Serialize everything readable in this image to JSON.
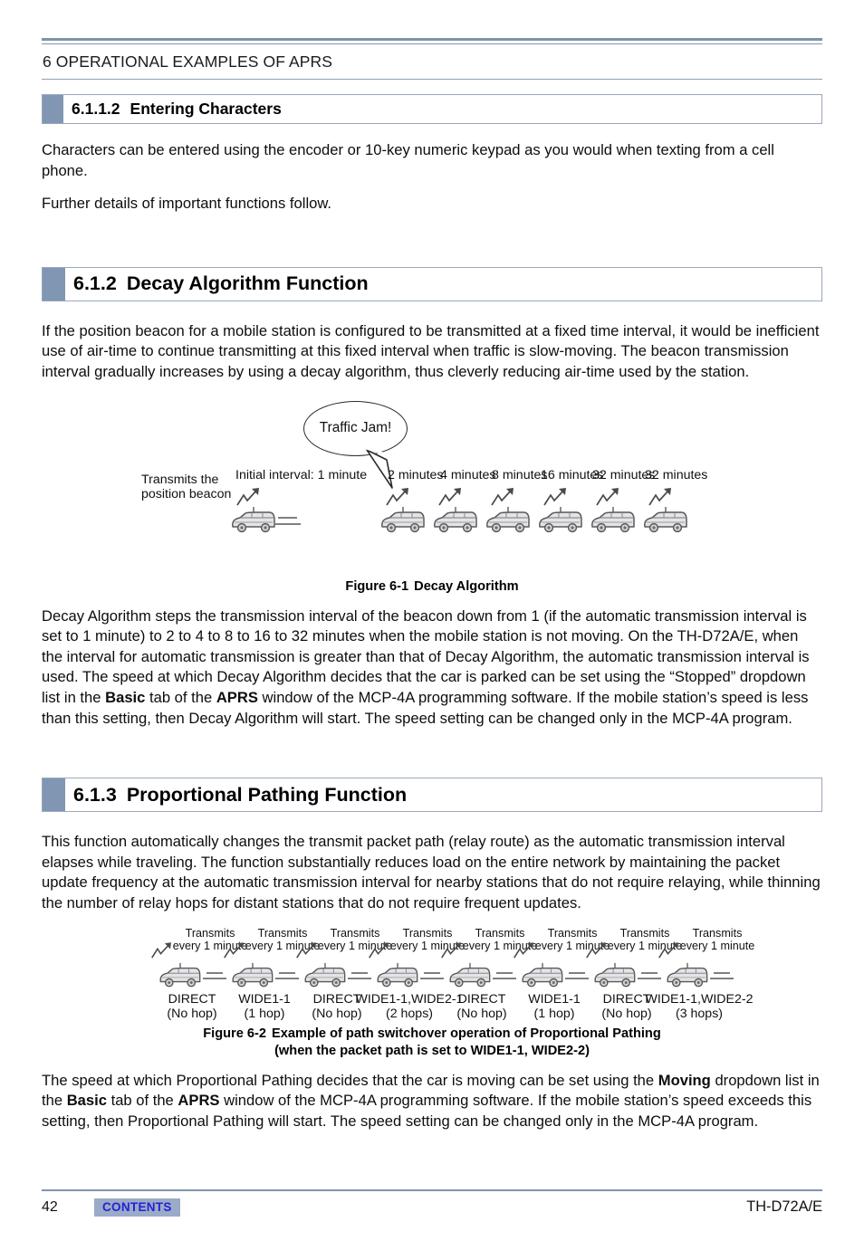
{
  "header": {
    "running_head": "6 OPERATIONAL EXAMPLES OF APRS"
  },
  "sections": [
    {
      "number": "6.1.1.2",
      "title": "Entering Characters",
      "level": 3,
      "paragraphs": [
        "Characters can be entered using the encoder or 10-key numeric keypad as you would when texting from a cell phone.",
        "Further details of important functions follow."
      ]
    },
    {
      "number": "6.1.2",
      "title": "Decay Algorithm Function",
      "level": 2,
      "intro": "If the position beacon for a mobile station is configured to be transmitted at a fixed time interval, it would be inefficient use of air-time to continue transmitting at this fixed interval when traffic is slow-moving.  The beacon transmission interval gradually increases by using a decay algorithm, thus cleverly reducing air-time used by the station."
    },
    {
      "number": "6.1.3",
      "title": "Proportional Pathing Function",
      "level": 2,
      "intro": "This function automatically changes the transmit packet path (relay route) as the automatic transmission interval elapses while traveling.  The function substantially reduces load on the entire network by maintaining the packet update frequency at the automatic transmission interval for nearby stations that do not require relaying, while thinning the number of relay hops for distant stations that do not require frequent updates."
    }
  ],
  "figure1": {
    "bubble_text": "Traffic Jam!",
    "beacon_label_line1": "Transmits the",
    "beacon_label_line2": "position beacon",
    "initial_label": "Initial interval: 1 minute",
    "interval_labels": [
      "2 minutes",
      "4 minutes",
      "8 minutes",
      "16 minutes",
      "32 minutes",
      "32 minutes"
    ],
    "caption_lead": "Figure 6-1",
    "caption_text": "Decay Algorithm"
  },
  "decay_body": {
    "para1_a": "Decay Algorithm steps the transmission interval of the beacon down from 1 (if the automatic transmission interval is set to 1 minute) to 2 to 4 to 8 to 16 to 32 minutes when the mobile station is not moving.  On the TH-D72A/E, when the interval for automatic transmission is greater than that of Decay Algorithm, the automatic transmission interval is used.  The speed at which Decay Algorithm decides that the car is parked can be set using the “Stopped” dropdown list in the ",
    "bold1": "Basic",
    "para1_b": " tab of the ",
    "bold2": "APRS",
    "para1_c": " window of the MCP-4A programming software.  If the mobile station’s speed is less than this setting, then Decay Algorithm will start.  The speed setting can be changed only in the MCP-4A program."
  },
  "figure2": {
    "transmit_line1": "Transmits",
    "transmit_line2": "every 1 minute",
    "stations": [
      {
        "path": "DIRECT",
        "hops": "(No hop)"
      },
      {
        "path": "WIDE1-1",
        "hops": "(1 hop)"
      },
      {
        "path": "DIRECT",
        "hops": "(No hop)"
      },
      {
        "path": "WIDE1-1,WIDE2-1",
        "hops": "(2 hops)"
      },
      {
        "path": "DIRECT",
        "hops": "(No hop)"
      },
      {
        "path": "WIDE1-1",
        "hops": "(1 hop)"
      },
      {
        "path": "DIRECT",
        "hops": "(No hop)"
      },
      {
        "path": "WIDE1-1,WIDE2-2",
        "hops": "(3 hops)"
      }
    ],
    "caption_lead": "Figure 6-2",
    "caption_line1": "Example of path switchover operation of Proportional Pathing",
    "caption_line2": "(when the packet path is set to WIDE1-1, WIDE2-2)"
  },
  "pathing_body": {
    "para_a": "The speed at which Proportional Pathing decides that the car is moving can be set using the ",
    "bold1": "Moving",
    "para_b": " dropdown list in the ",
    "bold2": "Basic",
    "para_c": " tab of the ",
    "bold3": "APRS",
    "para_d": " window of the MCP-4A programming software.  If the mobile station’s speed exceeds this setting, then Proportional Pathing will start.  The speed setting can be changed only in the MCP-4A program."
  },
  "footer": {
    "page_number": "42",
    "contents_label": "CONTENTS",
    "model": "TH-D72A/E"
  },
  "colors": {
    "rule": "#7f94ad",
    "section_tab": "#8096b2",
    "contents_bg": "#9aaac8",
    "contents_text": "#2323d6"
  }
}
